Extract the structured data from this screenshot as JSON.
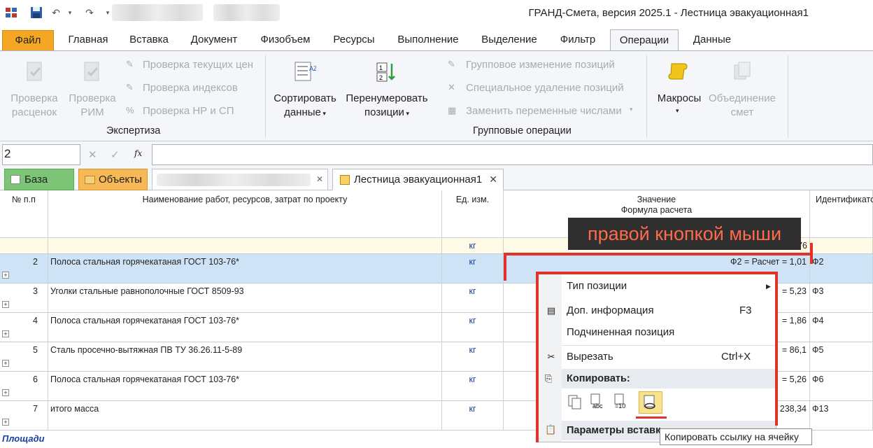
{
  "window": {
    "title": "ГРАНД-Смета, версия 2025.1 - Лестница эвакуационная1"
  },
  "quick_access": {
    "icons": [
      "app-grid-icon",
      "save-icon",
      "undo-icon",
      "redo-icon",
      "customize-arrow-icon"
    ]
  },
  "tabs": [
    "Файл",
    "Главная",
    "Вставка",
    "Документ",
    "Физобъем",
    "Ресурсы",
    "Выполнение",
    "Выделение",
    "Фильтр",
    "Операции",
    "Данные"
  ],
  "ribbon": {
    "expertise": {
      "check_prices": "Проверка расценок",
      "check_rim": "Проверка РИМ",
      "check_current_prices": "Проверка текущих цен",
      "check_indices": "Проверка индексов",
      "check_nr_sp": "Проверка НР и СП",
      "group_label": "Экспертиза"
    },
    "group_ops": {
      "sort_data": "Сортировать данные",
      "renumber": "Перенумеровать позиции",
      "group_change": "Групповое изменение позиций",
      "special_delete": "Специальное удаление позиций",
      "replace_vars": "Заменить переменные числами",
      "group_label": "Групповые операции"
    },
    "macros": "Макросы",
    "merge": "Объединение смет"
  },
  "formula_bar": {
    "name_box": "2",
    "fx": "fx",
    "cancel": "✕",
    "ok": "✓"
  },
  "doc_tabs": {
    "base": "База",
    "objects": "Объекты",
    "document": "Лестница эвакуационная1",
    "close": "✕"
  },
  "grid": {
    "headers": {
      "num": "№ п.п",
      "name": "Наименование работ, ресурсов, затрат по проекту",
      "unit": "Ед. изм.",
      "value_line1": "Значение",
      "value_line2": "Формула расчета",
      "id": "Идентификатор"
    },
    "top_row": {
      "unit": "кг",
      "value": "2 = 138,876"
    },
    "rows": [
      {
        "num": "2",
        "name": "Полоса стальная горячекатаная ГОСТ 103-76*",
        "unit": "кг",
        "value": "Ф2 = Расчет = 1,01",
        "id": "Ф2"
      },
      {
        "num": "3",
        "name": "Уголки стальные равнополочные ГОСТ 8509-93",
        "unit": "кг",
        "value": "= 5,23",
        "id": "Ф3"
      },
      {
        "num": "4",
        "name": "Полоса стальная горячекатаная ГОСТ 103-76*",
        "unit": "кг",
        "value": "= 1,86",
        "id": "Ф4"
      },
      {
        "num": "5",
        "name": "Сталь просечно-вытяжная ПВ ТУ 36.26.11-5-89",
        "unit": "кг",
        "value": "= 86,1",
        "id": "Ф5"
      },
      {
        "num": "6",
        "name": "Полоса стальная горячекатаная ГОСТ 103-76*",
        "unit": "кг",
        "value": "= 5,26",
        "id": "Ф6"
      },
      {
        "num": "7",
        "name": "итого масса",
        "unit": "кг",
        "value": "238,34",
        "id": "Ф13"
      }
    ],
    "section": "Площади"
  },
  "context_menu": {
    "position_type": "Тип позиции",
    "extra_info": "Доп. информация",
    "extra_info_shortcut": "F3",
    "sub_position": "Подчиненная позиция",
    "cut": "Вырезать",
    "cut_shortcut": "Ctrl+X",
    "copy_header": "Копировать:",
    "paste_header": "Параметры вставк",
    "copy_icons": [
      "copy-icon",
      "copy-values-icon",
      "copy-numbers-icon",
      "copy-cell-link-icon"
    ]
  },
  "annotation": {
    "banner": "правой кнопкой мыши",
    "tooltip": "Копировать ссылку на ячейку"
  },
  "colors": {
    "file_tab": "#f5a623",
    "selected_row": "#cfe3f7",
    "banner_bg": "#2f2f2f",
    "banner_text": "#ff6a4a",
    "highlight": "#e2322c"
  }
}
